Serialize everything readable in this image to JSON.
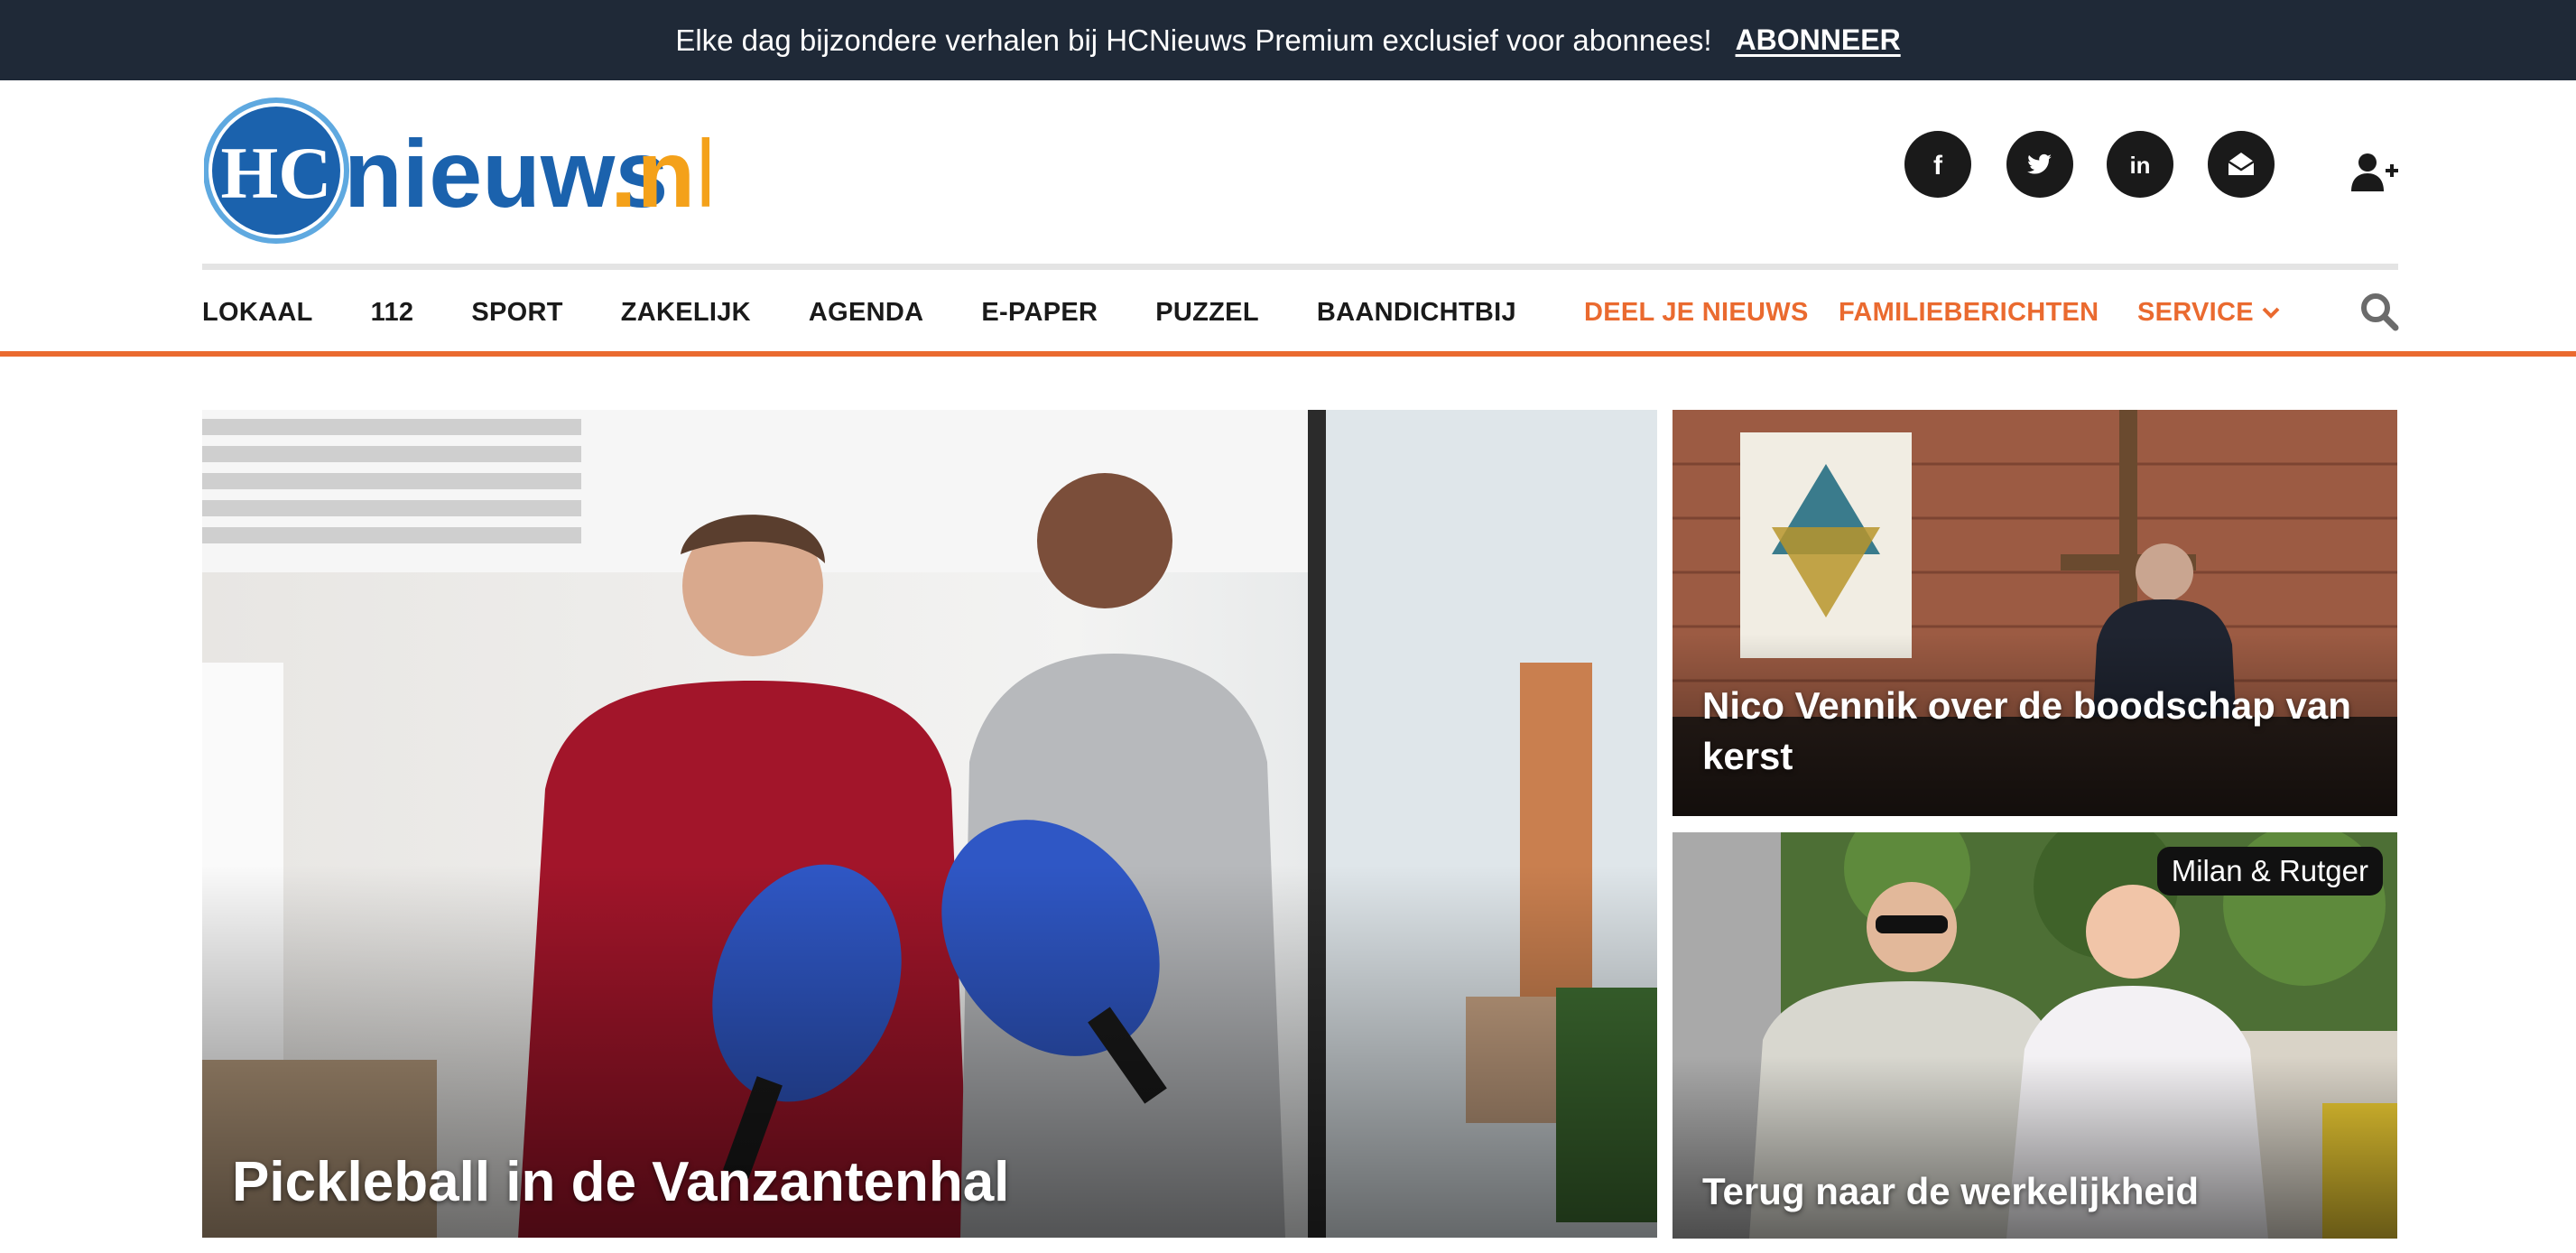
{
  "promo": {
    "text": "Elke dag bijzondere verhalen bij HCNieuws Premium exclusief voor abonnees!",
    "link": "ABONNEER"
  },
  "logo": {
    "mark": "HC",
    "word": "nieuws",
    "tld": ".nl"
  },
  "social": {
    "facebook_icon": "f",
    "linkedin_icon": "in"
  },
  "nav": {
    "items": [
      "LOKAAL",
      "112",
      "SPORT",
      "ZAKELIJK",
      "AGENDA",
      "E-PAPER",
      "PUZZEL",
      "BAANDICHTBIJ"
    ],
    "accent_items": [
      "DEEL JE NIEUWS",
      "FAMILIEBERICHTEN",
      "SERVICE"
    ]
  },
  "articles": {
    "main": {
      "title": "Pickleball in de Vanzantenhal"
    },
    "side_top": {
      "title": "Nico Vennik over de boodschap van kerst"
    },
    "side_bottom": {
      "title": "Terug naar de werkelijkheid",
      "tag": "Milan & Rutger"
    }
  },
  "colors": {
    "accent": "#ea6a2f",
    "promo_bg": "#1f2937",
    "logo_blue": "#1b62ad",
    "logo_orange": "#f4a11a"
  }
}
